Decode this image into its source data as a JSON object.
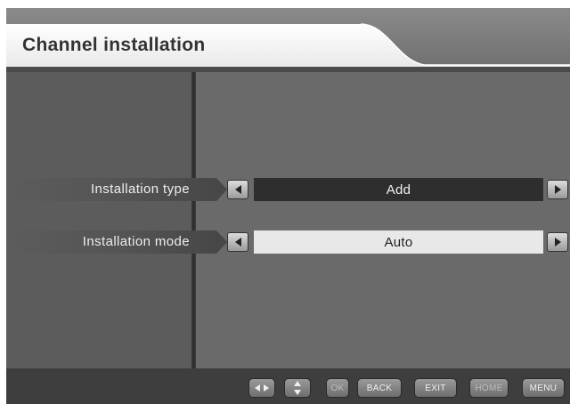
{
  "header": {
    "title": "Channel installation"
  },
  "rows": [
    {
      "label": "Installation type",
      "value": "Add"
    },
    {
      "label": "Installation mode",
      "value": "Auto"
    }
  ],
  "footer": {
    "leftright_icon": "left-right-arrows-icon",
    "updown_icon": "up-down-arrows-icon",
    "ok": "OK",
    "back": "BACK",
    "exit": "EXIT",
    "home": "HOME",
    "menu": "MENU"
  },
  "colors": {
    "background": "#5a5a5a",
    "header": "#f4f4f4",
    "selected_value_bg": "#2e2e2e",
    "value_bg": "#e8e8e8",
    "footer": "#3e3e3e"
  }
}
